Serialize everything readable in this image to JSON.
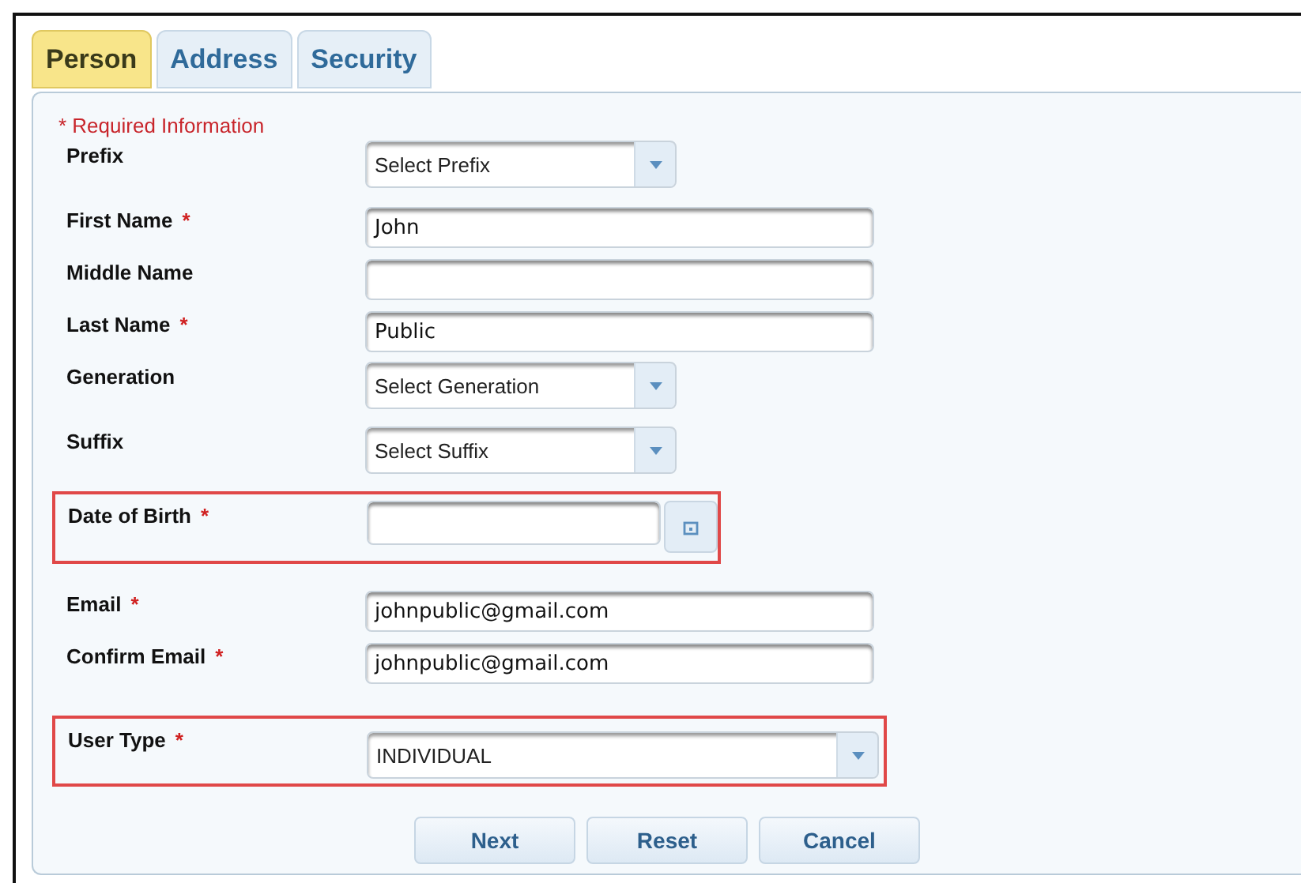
{
  "tabs": [
    {
      "label": "Person",
      "selected": true
    },
    {
      "label": "Address",
      "selected": false
    },
    {
      "label": "Security",
      "selected": false
    }
  ],
  "required_note": "* Required Information",
  "required_mark": "*",
  "fields": [
    {
      "kind": "select",
      "label": "Prefix",
      "required": false,
      "highlighted": false,
      "value": "Select Prefix"
    },
    {
      "kind": "text",
      "label": "First Name",
      "required": true,
      "highlighted": false,
      "value": "John"
    },
    {
      "kind": "text",
      "label": "Middle Name",
      "required": false,
      "highlighted": false
    },
    {
      "kind": "text",
      "label": "Last Name",
      "required": true,
      "highlighted": false,
      "value": "Public"
    },
    {
      "kind": "select",
      "label": "Generation",
      "required": false,
      "highlighted": false,
      "value": "Select Generation"
    },
    {
      "kind": "select",
      "label": "Suffix",
      "required": false,
      "highlighted": false,
      "value": "Select Suffix"
    },
    {
      "kind": "date",
      "label": "Date of Birth",
      "required": true,
      "highlighted": true
    },
    {
      "kind": "text",
      "label": "Email",
      "required": true,
      "highlighted": false,
      "value": "johnpublic@gmail.com"
    },
    {
      "kind": "text",
      "label": "Confirm Email",
      "required": true,
      "highlighted": false,
      "value": "johnpublic@gmail.com"
    },
    {
      "kind": "wideselect",
      "label": "User Type",
      "required": true,
      "highlighted": true,
      "value": "INDIVIDUAL"
    }
  ],
  "buttons": [
    "Next",
    "Reset",
    "Cancel"
  ]
}
